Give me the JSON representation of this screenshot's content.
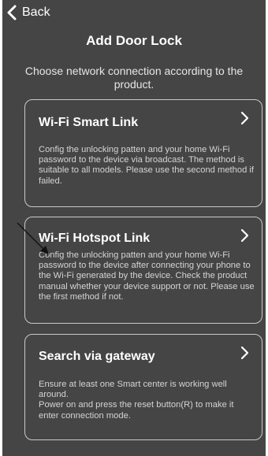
{
  "header": {
    "back_label": "Back",
    "title": "Add Door Lock"
  },
  "subtitle": "Choose network connection according to the product.",
  "options": [
    {
      "title": "Wi-Fi Smart Link",
      "description": "Config the unlocking patten and your home Wi-Fi password to the device via broadcast. The method is suitable to all models. Please use the second method if failed."
    },
    {
      "title": "Wi-Fi Hotspot Link",
      "description": "Config the unlocking patten and your home Wi-Fi password to the device after connecting your phone to the Wi-Fi generated by the device. Check the product manual whether your device support or not. Please use the first method if not."
    },
    {
      "title": "Search via gateway",
      "description_lines": [
        "Ensure at least one Smart center is working well around.",
        "Power on and press the reset button(R) to make it enter connection mode."
      ]
    }
  ],
  "icons": {
    "back": "chevron-left-icon",
    "card_arrow": "chevron-right-icon",
    "annotation": "pointer-arrow-icon"
  },
  "colors": {
    "background": "#454545",
    "card_border": "#c9c9c9",
    "text": "#ffffff"
  }
}
